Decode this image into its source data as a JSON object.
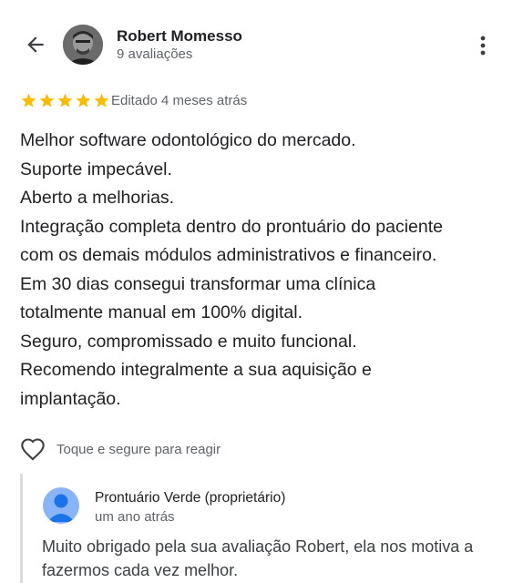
{
  "review": {
    "author": {
      "name": "Robert Momesso",
      "subtitle": "9 avaliações"
    },
    "rating": 5,
    "star_color": "#fbbc04",
    "edited_label": "Editado 4 meses atrás",
    "lines": [
      "Melhor software odontológico do mercado.",
      "Suporte impecável.",
      "Aberto a melhorias.",
      "Integração completa dentro do prontuário do paciente",
      "com os demais módulos administrativos e financeiro.",
      "Em 30 dias consegui transformar uma clínica",
      "totalmente manual em 100% digital.",
      "Seguro, compromissado e muito funcional.",
      "Recomendo integralmente a sua aquisição e",
      "implantação."
    ],
    "react_label": "Toque e segure para reagir"
  },
  "owner_reply": {
    "name": "Prontuário Verde (proprietário)",
    "time": "um ano atrás",
    "lines": [
      "Muito obrigado pela sua avaliação Robert, ela nos motiva a",
      "fazermos cada vez melhor."
    ],
    "avatar_color": "#8ab4f8"
  },
  "icons": {
    "back": "arrow-left-icon",
    "more": "more-vert-icon",
    "heart": "heart-outline-icon",
    "star": "star-icon"
  }
}
